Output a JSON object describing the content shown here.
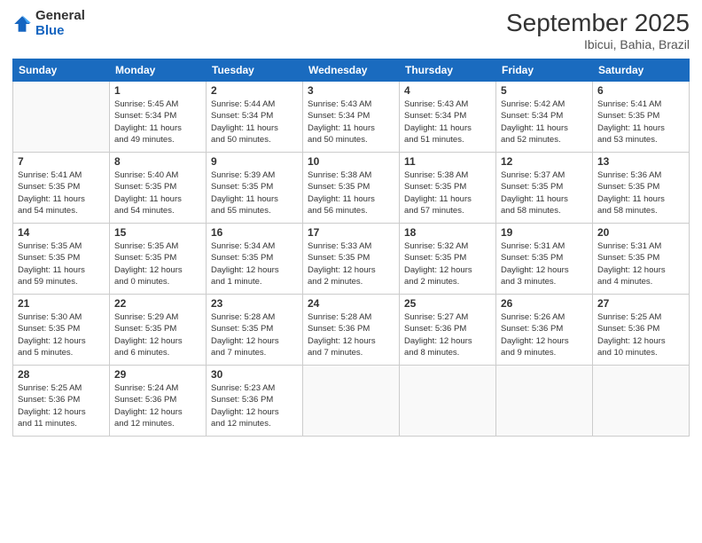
{
  "logo": {
    "general": "General",
    "blue": "Blue"
  },
  "title": "September 2025",
  "subtitle": "Ibicui, Bahia, Brazil",
  "days_of_week": [
    "Sunday",
    "Monday",
    "Tuesday",
    "Wednesday",
    "Thursday",
    "Friday",
    "Saturday"
  ],
  "weeks": [
    [
      {
        "day": "",
        "info": ""
      },
      {
        "day": "1",
        "info": "Sunrise: 5:45 AM\nSunset: 5:34 PM\nDaylight: 11 hours\nand 49 minutes."
      },
      {
        "day": "2",
        "info": "Sunrise: 5:44 AM\nSunset: 5:34 PM\nDaylight: 11 hours\nand 50 minutes."
      },
      {
        "day": "3",
        "info": "Sunrise: 5:43 AM\nSunset: 5:34 PM\nDaylight: 11 hours\nand 50 minutes."
      },
      {
        "day": "4",
        "info": "Sunrise: 5:43 AM\nSunset: 5:34 PM\nDaylight: 11 hours\nand 51 minutes."
      },
      {
        "day": "5",
        "info": "Sunrise: 5:42 AM\nSunset: 5:34 PM\nDaylight: 11 hours\nand 52 minutes."
      },
      {
        "day": "6",
        "info": "Sunrise: 5:41 AM\nSunset: 5:35 PM\nDaylight: 11 hours\nand 53 minutes."
      }
    ],
    [
      {
        "day": "7",
        "info": "Sunrise: 5:41 AM\nSunset: 5:35 PM\nDaylight: 11 hours\nand 54 minutes."
      },
      {
        "day": "8",
        "info": "Sunrise: 5:40 AM\nSunset: 5:35 PM\nDaylight: 11 hours\nand 54 minutes."
      },
      {
        "day": "9",
        "info": "Sunrise: 5:39 AM\nSunset: 5:35 PM\nDaylight: 11 hours\nand 55 minutes."
      },
      {
        "day": "10",
        "info": "Sunrise: 5:38 AM\nSunset: 5:35 PM\nDaylight: 11 hours\nand 56 minutes."
      },
      {
        "day": "11",
        "info": "Sunrise: 5:38 AM\nSunset: 5:35 PM\nDaylight: 11 hours\nand 57 minutes."
      },
      {
        "day": "12",
        "info": "Sunrise: 5:37 AM\nSunset: 5:35 PM\nDaylight: 11 hours\nand 58 minutes."
      },
      {
        "day": "13",
        "info": "Sunrise: 5:36 AM\nSunset: 5:35 PM\nDaylight: 11 hours\nand 58 minutes."
      }
    ],
    [
      {
        "day": "14",
        "info": "Sunrise: 5:35 AM\nSunset: 5:35 PM\nDaylight: 11 hours\nand 59 minutes."
      },
      {
        "day": "15",
        "info": "Sunrise: 5:35 AM\nSunset: 5:35 PM\nDaylight: 12 hours\nand 0 minutes."
      },
      {
        "day": "16",
        "info": "Sunrise: 5:34 AM\nSunset: 5:35 PM\nDaylight: 12 hours\nand 1 minute."
      },
      {
        "day": "17",
        "info": "Sunrise: 5:33 AM\nSunset: 5:35 PM\nDaylight: 12 hours\nand 2 minutes."
      },
      {
        "day": "18",
        "info": "Sunrise: 5:32 AM\nSunset: 5:35 PM\nDaylight: 12 hours\nand 2 minutes."
      },
      {
        "day": "19",
        "info": "Sunrise: 5:31 AM\nSunset: 5:35 PM\nDaylight: 12 hours\nand 3 minutes."
      },
      {
        "day": "20",
        "info": "Sunrise: 5:31 AM\nSunset: 5:35 PM\nDaylight: 12 hours\nand 4 minutes."
      }
    ],
    [
      {
        "day": "21",
        "info": "Sunrise: 5:30 AM\nSunset: 5:35 PM\nDaylight: 12 hours\nand 5 minutes."
      },
      {
        "day": "22",
        "info": "Sunrise: 5:29 AM\nSunset: 5:35 PM\nDaylight: 12 hours\nand 6 minutes."
      },
      {
        "day": "23",
        "info": "Sunrise: 5:28 AM\nSunset: 5:35 PM\nDaylight: 12 hours\nand 7 minutes."
      },
      {
        "day": "24",
        "info": "Sunrise: 5:28 AM\nSunset: 5:36 PM\nDaylight: 12 hours\nand 7 minutes."
      },
      {
        "day": "25",
        "info": "Sunrise: 5:27 AM\nSunset: 5:36 PM\nDaylight: 12 hours\nand 8 minutes."
      },
      {
        "day": "26",
        "info": "Sunrise: 5:26 AM\nSunset: 5:36 PM\nDaylight: 12 hours\nand 9 minutes."
      },
      {
        "day": "27",
        "info": "Sunrise: 5:25 AM\nSunset: 5:36 PM\nDaylight: 12 hours\nand 10 minutes."
      }
    ],
    [
      {
        "day": "28",
        "info": "Sunrise: 5:25 AM\nSunset: 5:36 PM\nDaylight: 12 hours\nand 11 minutes."
      },
      {
        "day": "29",
        "info": "Sunrise: 5:24 AM\nSunset: 5:36 PM\nDaylight: 12 hours\nand 12 minutes."
      },
      {
        "day": "30",
        "info": "Sunrise: 5:23 AM\nSunset: 5:36 PM\nDaylight: 12 hours\nand 12 minutes."
      },
      {
        "day": "",
        "info": ""
      },
      {
        "day": "",
        "info": ""
      },
      {
        "day": "",
        "info": ""
      },
      {
        "day": "",
        "info": ""
      }
    ]
  ]
}
